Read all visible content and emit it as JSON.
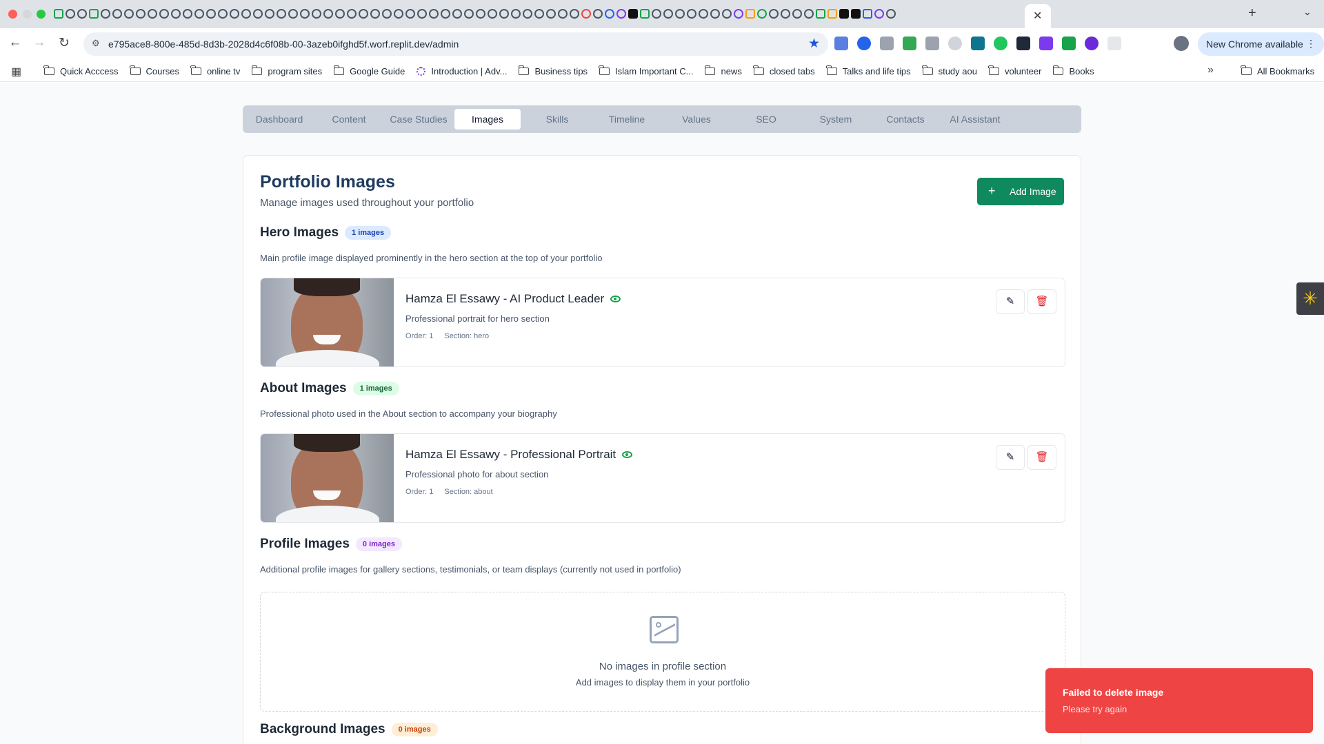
{
  "browser": {
    "url": "e795ace8-800e-485d-8d3b-2028d4c6f08b-00-3azeb0ifghd5f.worf.replit.dev/admin",
    "new_chrome_label": "New Chrome available",
    "bookmarks": [
      "Quick Acccess",
      "Courses",
      "online tv",
      "program sites",
      "Google Guide",
      "Introduction | Adv...",
      "Business tips",
      "Islam Important C...",
      "news",
      "closed tabs",
      "Talks and life tips",
      "study aou",
      "volunteer",
      "Books"
    ],
    "all_bookmarks": "All Bookmarks"
  },
  "admin_tabs": [
    "Dashboard",
    "Content",
    "Case Studies",
    "Images",
    "Skills",
    "Timeline",
    "Values",
    "SEO",
    "System",
    "Contacts",
    "AI Assistant"
  ],
  "active_tab": "Images",
  "header": {
    "title": "Portfolio Images",
    "subtitle": "Manage images used throughout your portfolio",
    "add_button": "Add Image"
  },
  "sections": {
    "hero": {
      "title": "Hero Images",
      "badge": "1 images",
      "description": "Main profile image displayed prominently in the hero section at the top of your portfolio",
      "items": [
        {
          "title": "Hamza El Essawy - AI Product Leader",
          "description": "Professional portrait for hero section",
          "order": "Order: 1",
          "section": "Section: hero"
        }
      ]
    },
    "about": {
      "title": "About Images",
      "badge": "1 images",
      "description": "Professional photo used in the About section to accompany your biography",
      "items": [
        {
          "title": "Hamza El Essawy - Professional Portrait",
          "description": "Professional photo for about section",
          "order": "Order: 1",
          "section": "Section: about"
        }
      ]
    },
    "profile": {
      "title": "Profile Images",
      "badge": "0 images",
      "description": "Additional profile images for gallery sections, testimonials, or team displays (currently not used in portfolio)",
      "empty_title": "No images in profile section",
      "empty_sub": "Add images to display them in your portfolio"
    },
    "background": {
      "title": "Background Images",
      "badge": "0 images"
    }
  },
  "toast": {
    "title": "Failed to delete image",
    "message": "Please try again",
    "color": "#ef4444"
  },
  "colors": {
    "accent": "#0f8a5f",
    "title": "#1e3a5f"
  }
}
